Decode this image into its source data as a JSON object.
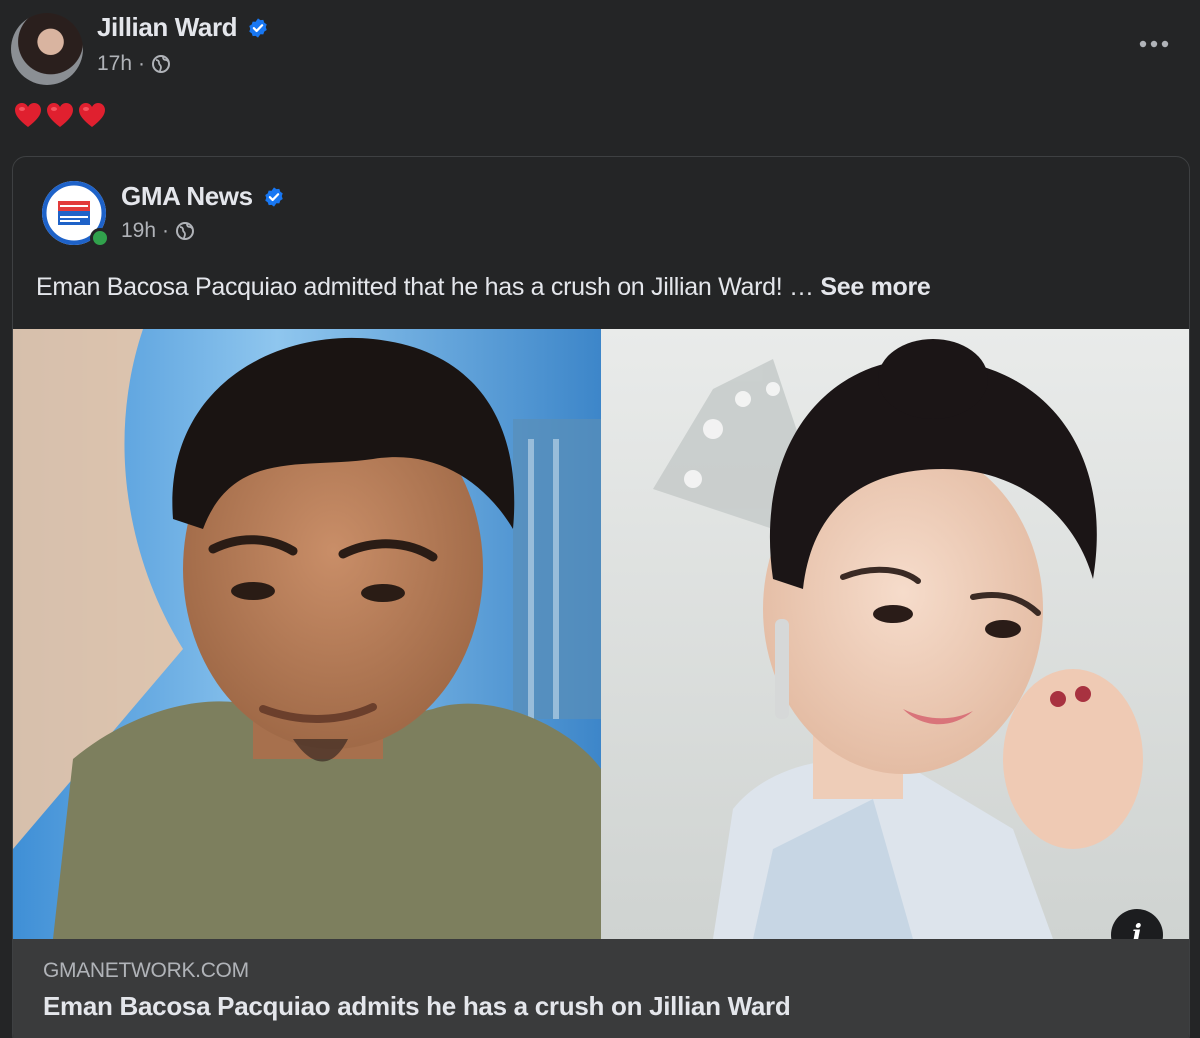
{
  "post": {
    "author_name": "Jillian Ward",
    "timestamp": "17h",
    "separator": "·",
    "audience_icon": "globe-icon",
    "more_label": "•••",
    "content_icons": [
      "heart-icon",
      "heart-icon",
      "heart-icon"
    ]
  },
  "shared_post": {
    "author_name": "GMA News",
    "timestamp": "19h",
    "separator": "·",
    "audience_icon": "globe-icon",
    "caption": "Eman Bacosa Pacquiao admitted that he has a crush on Jillian Ward! … ",
    "see_more": "See more"
  },
  "link_preview": {
    "domain": "GMANETWORK.COM",
    "title": "Eman Bacosa Pacquiao admits he has a crush on Jillian Ward",
    "info_label": "i"
  },
  "colors": {
    "background": "#242526",
    "text_primary": "#e4e6eb",
    "text_secondary": "#b0b3b8",
    "verified_blue": "#1877f2",
    "heart_red": "#e0202f",
    "online_green": "#31a24c",
    "link_box": "#3a3b3c"
  }
}
